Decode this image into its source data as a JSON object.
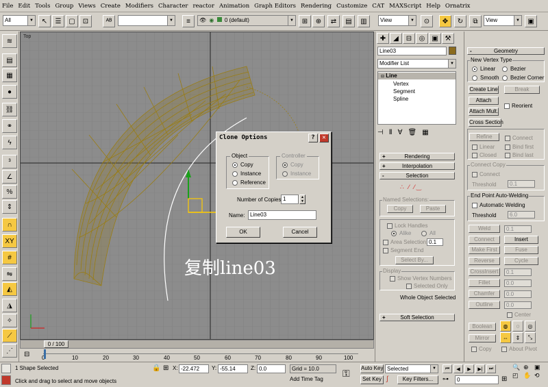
{
  "menu": [
    "File",
    "Edit",
    "Tools",
    "Group",
    "Views",
    "Create",
    "Modifiers",
    "Character",
    "reactor",
    "Animation",
    "Graph Editors",
    "Rendering",
    "Customize",
    "CAT",
    "MAXScript",
    "Help",
    "Ornatrix"
  ],
  "toolbar": {
    "selection_filter": "All",
    "named_selection": "",
    "layer": "0 (default)",
    "ref_coord_left": "View",
    "ref_coord_right": "View"
  },
  "viewport": {
    "label": "Top",
    "caption": "复制line03"
  },
  "dialog": {
    "title": "Clone Options",
    "help": "?",
    "close": "✕",
    "object_group": "Object",
    "object_options": [
      "Copy",
      "Instance",
      "Reference"
    ],
    "object_selected": "Copy",
    "controller_group": "Controller",
    "controller_options": [
      "Copy",
      "Instance"
    ],
    "copies_label": "Number of Copies:",
    "copies_value": "1",
    "name_label": "Name:",
    "name_value": "Line03",
    "ok": "OK",
    "cancel": "Cancel"
  },
  "command_panel": {
    "object_name": "Line03",
    "color": "#8b6b1e",
    "modifier_list": "Modifier List",
    "stack": [
      "Line",
      "Vertex",
      "Segment",
      "Spline"
    ],
    "rollouts": {
      "rendering": "Rendering",
      "interpolation": "Interpolation",
      "selection": "Selection",
      "soft_selection": "Soft Selection"
    },
    "named_selections": "Named Selections:",
    "copy": "Copy",
    "paste": "Paste",
    "lock_handles": "Lock Handles",
    "alike": "Alike",
    "all": "All",
    "area_selection": "Area Selection:",
    "area_value": "0.1",
    "segment_end": "Segment End",
    "select_by": "Select By...",
    "display": "Display",
    "show_vertex_numbers": "Show Vertex Numbers",
    "selected_only": "Selected Only",
    "whole_object_selected": "Whole Object Selected"
  },
  "geometry": {
    "title": "Geometry",
    "new_vertex_type": "New Vertex Type",
    "vertex_types": [
      "Linear",
      "Bezier",
      "Smooth",
      "Bezier Corner"
    ],
    "create_line": "Create Line",
    "break": "Break",
    "attach": "Attach",
    "reorient": "Reorient",
    "attach_mult": "Attach Mult.",
    "cross_section": "Cross Section",
    "refine": "Refine",
    "connect": "Connect",
    "linear": "Linear",
    "bind_first": "Bind first",
    "closed": "Closed",
    "bind_last": "Bind last",
    "connect_copy": "Connect Copy",
    "connect2": "Connect",
    "threshold": "Threshold",
    "threshold_value": "0.1",
    "end_point_auto_welding": "End Point Auto-Welding",
    "automatic_welding": "Automatic Welding",
    "threshold2_value": "6.0",
    "weld": "Weld",
    "weld_value": "0.1",
    "connect3": "Connect",
    "insert": "Insert",
    "make_first": "Make First",
    "fuse": "Fuse",
    "reverse": "Reverse",
    "cycle": "Cycle",
    "crossinsert": "CrossInsert",
    "crossinsert_value": "0.1",
    "fillet": "Fillet",
    "fillet_value": "0.0",
    "chamfer": "Chamfer",
    "chamfer_value": "0.0",
    "outline": "Outline",
    "outline_value": "0.0",
    "center": "Center",
    "boolean": "Boolean",
    "mirror": "Mirror",
    "copy": "Copy",
    "about_pivot": "About Pivot"
  },
  "timeline": {
    "frame": "0 / 100",
    "ticks": [
      "0",
      "10",
      "20",
      "30",
      "40",
      "50",
      "60",
      "70",
      "80",
      "90",
      "100"
    ]
  },
  "status": {
    "shapes_selected": "1 Shape Selected",
    "prompt": "Click and drag to select and move objects",
    "x_label": "X:",
    "x_value": "-22.472",
    "y_label": "Y:",
    "y_value": "-55.14",
    "z_label": "Z:",
    "z_value": "0.0",
    "grid": "Grid = 10.0",
    "add_time_tag": "Add Time Tag",
    "auto_key": "Auto Key",
    "set_key": "Set Key",
    "selected": "Selected",
    "key_filters": "Key Filters...",
    "current_frame": "0"
  }
}
